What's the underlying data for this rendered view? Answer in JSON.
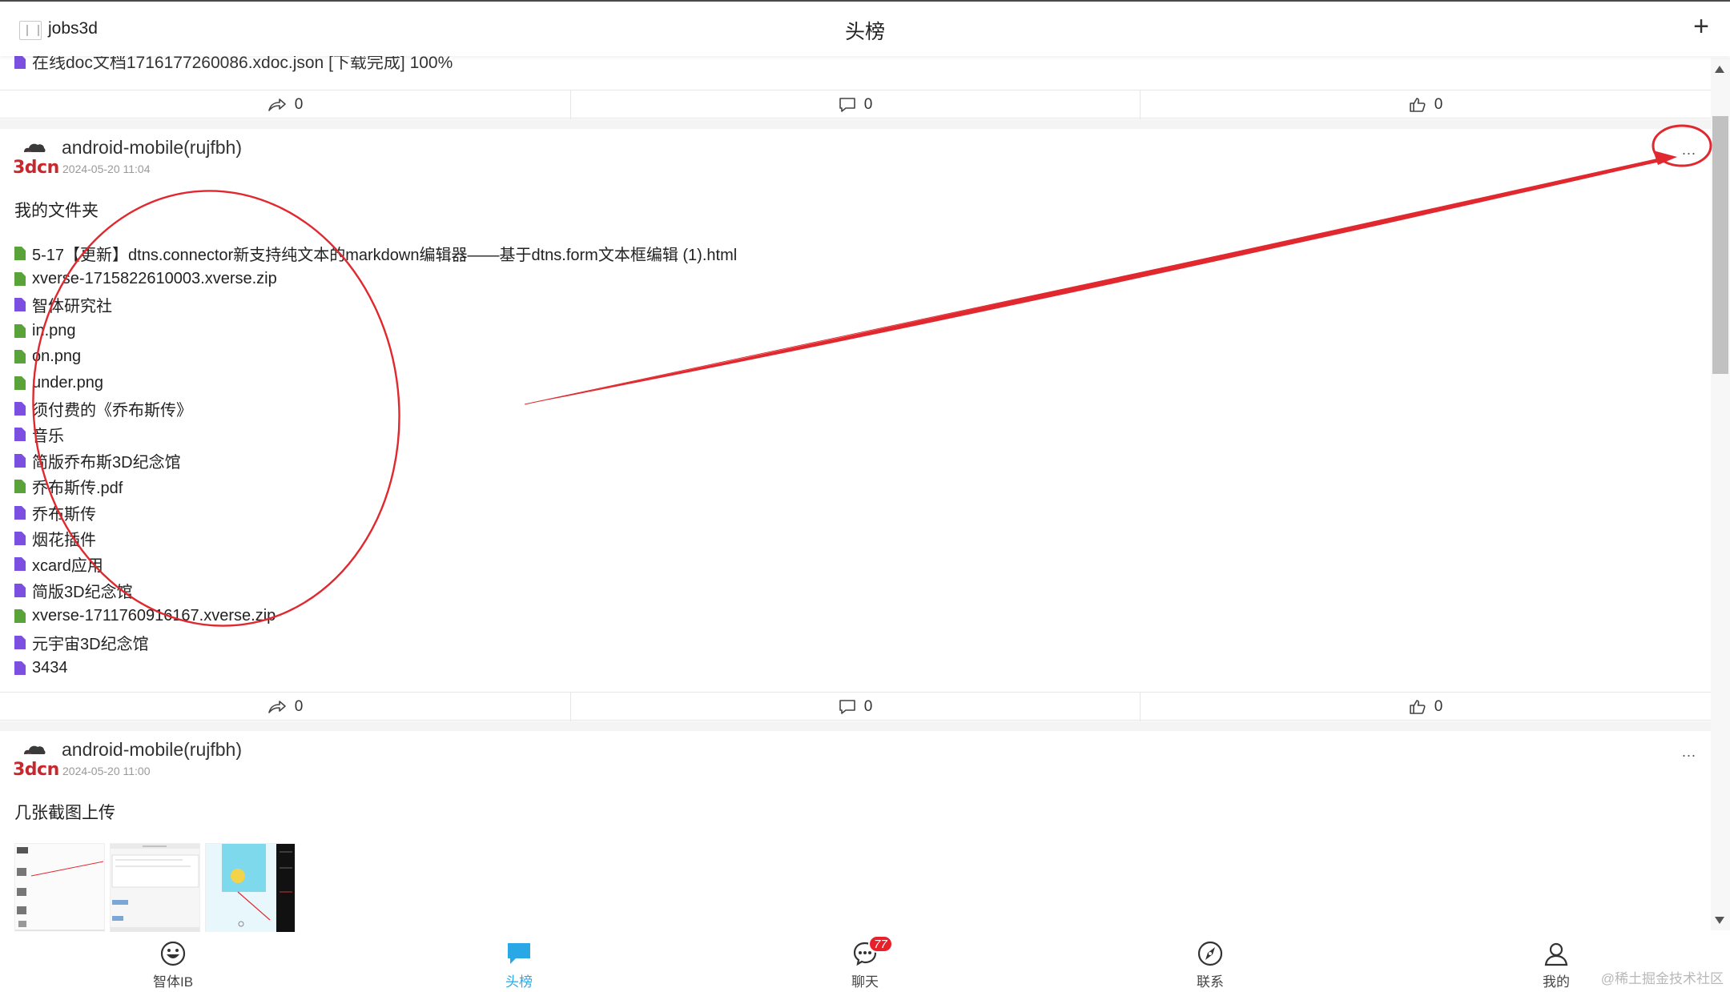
{
  "header": {
    "app_name": "jobs3d",
    "title": "头榜",
    "add_label": "+"
  },
  "remnant": {
    "text": "在线doc文档1716177260086.xdoc.json  [下载完成]  100%"
  },
  "actions": {
    "share_count": "0",
    "comment_count": "0",
    "like_count": "0"
  },
  "posts": [
    {
      "author": "android-mobile(rujfbh)",
      "brand": "3dcn",
      "time": "2024-05-20 11:04",
      "more": "...",
      "text": "我的文件夹",
      "files": [
        {
          "name": "5-17【更新】dtns.connector新支持纯文本的markdown编辑器——基于dtns.form文本框编辑 (1).html",
          "kind": "file"
        },
        {
          "name": "xverse-1715822610003.xverse.zip",
          "kind": "file"
        },
        {
          "name": "智体研究社",
          "kind": "folder"
        },
        {
          "name": "in.png",
          "kind": "file"
        },
        {
          "name": "on.png",
          "kind": "file"
        },
        {
          "name": "under.png",
          "kind": "file"
        },
        {
          "name": "须付费的《乔布斯传》",
          "kind": "folder"
        },
        {
          "name": "音乐",
          "kind": "folder"
        },
        {
          "name": "简版乔布斯3D纪念馆",
          "kind": "folder"
        },
        {
          "name": "乔布斯传.pdf",
          "kind": "file"
        },
        {
          "name": "乔布斯传",
          "kind": "folder"
        },
        {
          "name": "烟花插件",
          "kind": "folder"
        },
        {
          "name": "xcard应用",
          "kind": "folder"
        },
        {
          "name": "简版3D纪念馆",
          "kind": "folder"
        },
        {
          "name": "xverse-1711760916167.xverse.zip",
          "kind": "file"
        },
        {
          "name": "元宇宙3D纪念馆",
          "kind": "folder"
        },
        {
          "name": "3434",
          "kind": "folder"
        }
      ],
      "share_count": "0",
      "comment_count": "0",
      "like_count": "0"
    },
    {
      "author": "android-mobile(rujfbh)",
      "brand": "3dcn",
      "time": "2024-05-20 11:00",
      "more": "...",
      "text": "几张截图上传"
    }
  ],
  "nav": {
    "items": [
      {
        "label": "智体IB",
        "icon": "smile-icon"
      },
      {
        "label": "头榜",
        "icon": "chat-bubble-icon",
        "active": true
      },
      {
        "label": "聊天",
        "icon": "message-icon",
        "badge": "77"
      },
      {
        "label": "联系",
        "icon": "compass-icon"
      },
      {
        "label": "我的",
        "icon": "user-icon"
      }
    ]
  },
  "watermark": "@稀土掘金技术社区",
  "colors": {
    "accent": "#2aa8e6",
    "brand_red": "#c8282d",
    "annotation_red": "#e0282e",
    "file_green": "#5aa33a",
    "folder_purple": "#7b4fe0",
    "badge_red": "#e8202a"
  }
}
